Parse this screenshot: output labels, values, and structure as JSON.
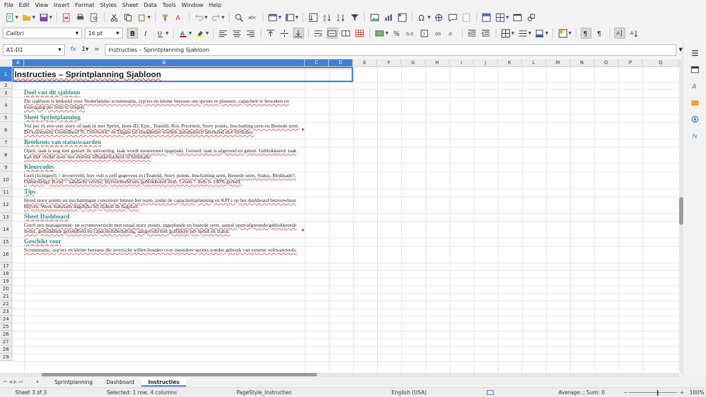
{
  "menu": [
    "File",
    "Edit",
    "View",
    "Insert",
    "Format",
    "Styles",
    "Sheet",
    "Data",
    "Tools",
    "Window",
    "Help"
  ],
  "font": {
    "name": "Calibri",
    "size": "16 pt"
  },
  "formula": {
    "cell_ref": "A1:D1",
    "content": "Instructies – Sprintplanning Sjabloon"
  },
  "columns": [
    "A",
    "B",
    "C",
    "D",
    "E",
    "F",
    "G",
    "H",
    "I",
    "J",
    "K",
    "L",
    "M",
    "N",
    "O",
    "P",
    "Q"
  ],
  "rows": [
    "1",
    "2",
    "3",
    "4",
    "5",
    "6",
    "7",
    "8",
    "9",
    "10",
    "11",
    "12",
    "13",
    "14",
    "15",
    "16",
    "17",
    "18",
    "19",
    "20",
    "21",
    "22",
    "23",
    "24",
    "25",
    "26",
    "27",
    "28",
    "29"
  ],
  "title": "Instructies – Sprintplanning Sjabloon",
  "content": [
    {
      "heading": "Doel van dit sjabloon",
      "body": "Dit sjabloon is bedoeld voor Nederlandse scrumteams, zzp'ers en kleine bureaus om sprints te plannen, capaciteit te bewaken en voortgang per item te volgen."
    },
    {
      "heading": "Sheet Sprintplanning",
      "body": "Vul per rij een user story of taak in met Sprint, Item-ID, Epic, TeamId, Rol, Prioriteit, Story points, Inschatting uren en Bestede uren. De kolommen Gereedheid %, Overwerk? en Dagen tot einddatum worden automatisch berekend met formules."
    },
    {
      "heading": "Betekenis van statuswaarden",
      "body": "Open: taak is nog niet gestart. In uitvoering: taak wordt momenteel opgepakt. Gereed: taak is afgerond en getest. Geblokkeerd: taak kan niet verder door een externe afhankelijkheid of blokkade."
    },
    {
      "heading": "Kleurcodes",
      "body": "Geel (lichtgeel) = invoerveld, hier vult u zelf gegevens in (TeamId, Story points, Inschatting uren, Bestede uren, Status, Blokkade?, Opmerking). Rood = aandacht vereist, bijvoorbeeld een geblokkeerd item. Groen = item is 100% gereed."
    },
    {
      "heading": "Tips",
      "body": "Houd story points en inschattingen consistent binnen het team, zodat de capaciteitsplanning en KPI's op het dashboard betrouwbaar blijven. Werk statussen dagelijks bij tijdens de dagstart."
    },
    {
      "heading": "Sheet Dashboard",
      "body": "Geeft een management- en scrumoverzicht met totaal story points, ingeplande en bestede uren, aantal open/afgeronde/geblokkeerde items, gemiddelde gereedheid en capaciteitsbenutting, aangevuld met grafieken per sprint en status."
    },
    {
      "heading": "Geschikt voor",
      "body": "Scrumteams, zzp'ers en kleine bureaus die overzicht willen houden over meerdere sprints zonder gebruik van externe softwaretools."
    }
  ],
  "sheets": {
    "new_tab": "+",
    "tabs": [
      "Sprintplanning",
      "Dashboard",
      "Instructies"
    ],
    "active": "Instructies"
  },
  "status": {
    "sheet": "Sheet 3 of 3",
    "selection": "Selected: 1 row, 4 columns",
    "page_style": "PageStyle_Instructies",
    "language": "English (USA)",
    "summary": "Average: ; Sum: 0",
    "zoom": "100%"
  },
  "colors": {
    "accent": "#3f7fd6",
    "heading": "#2a8a8a"
  }
}
